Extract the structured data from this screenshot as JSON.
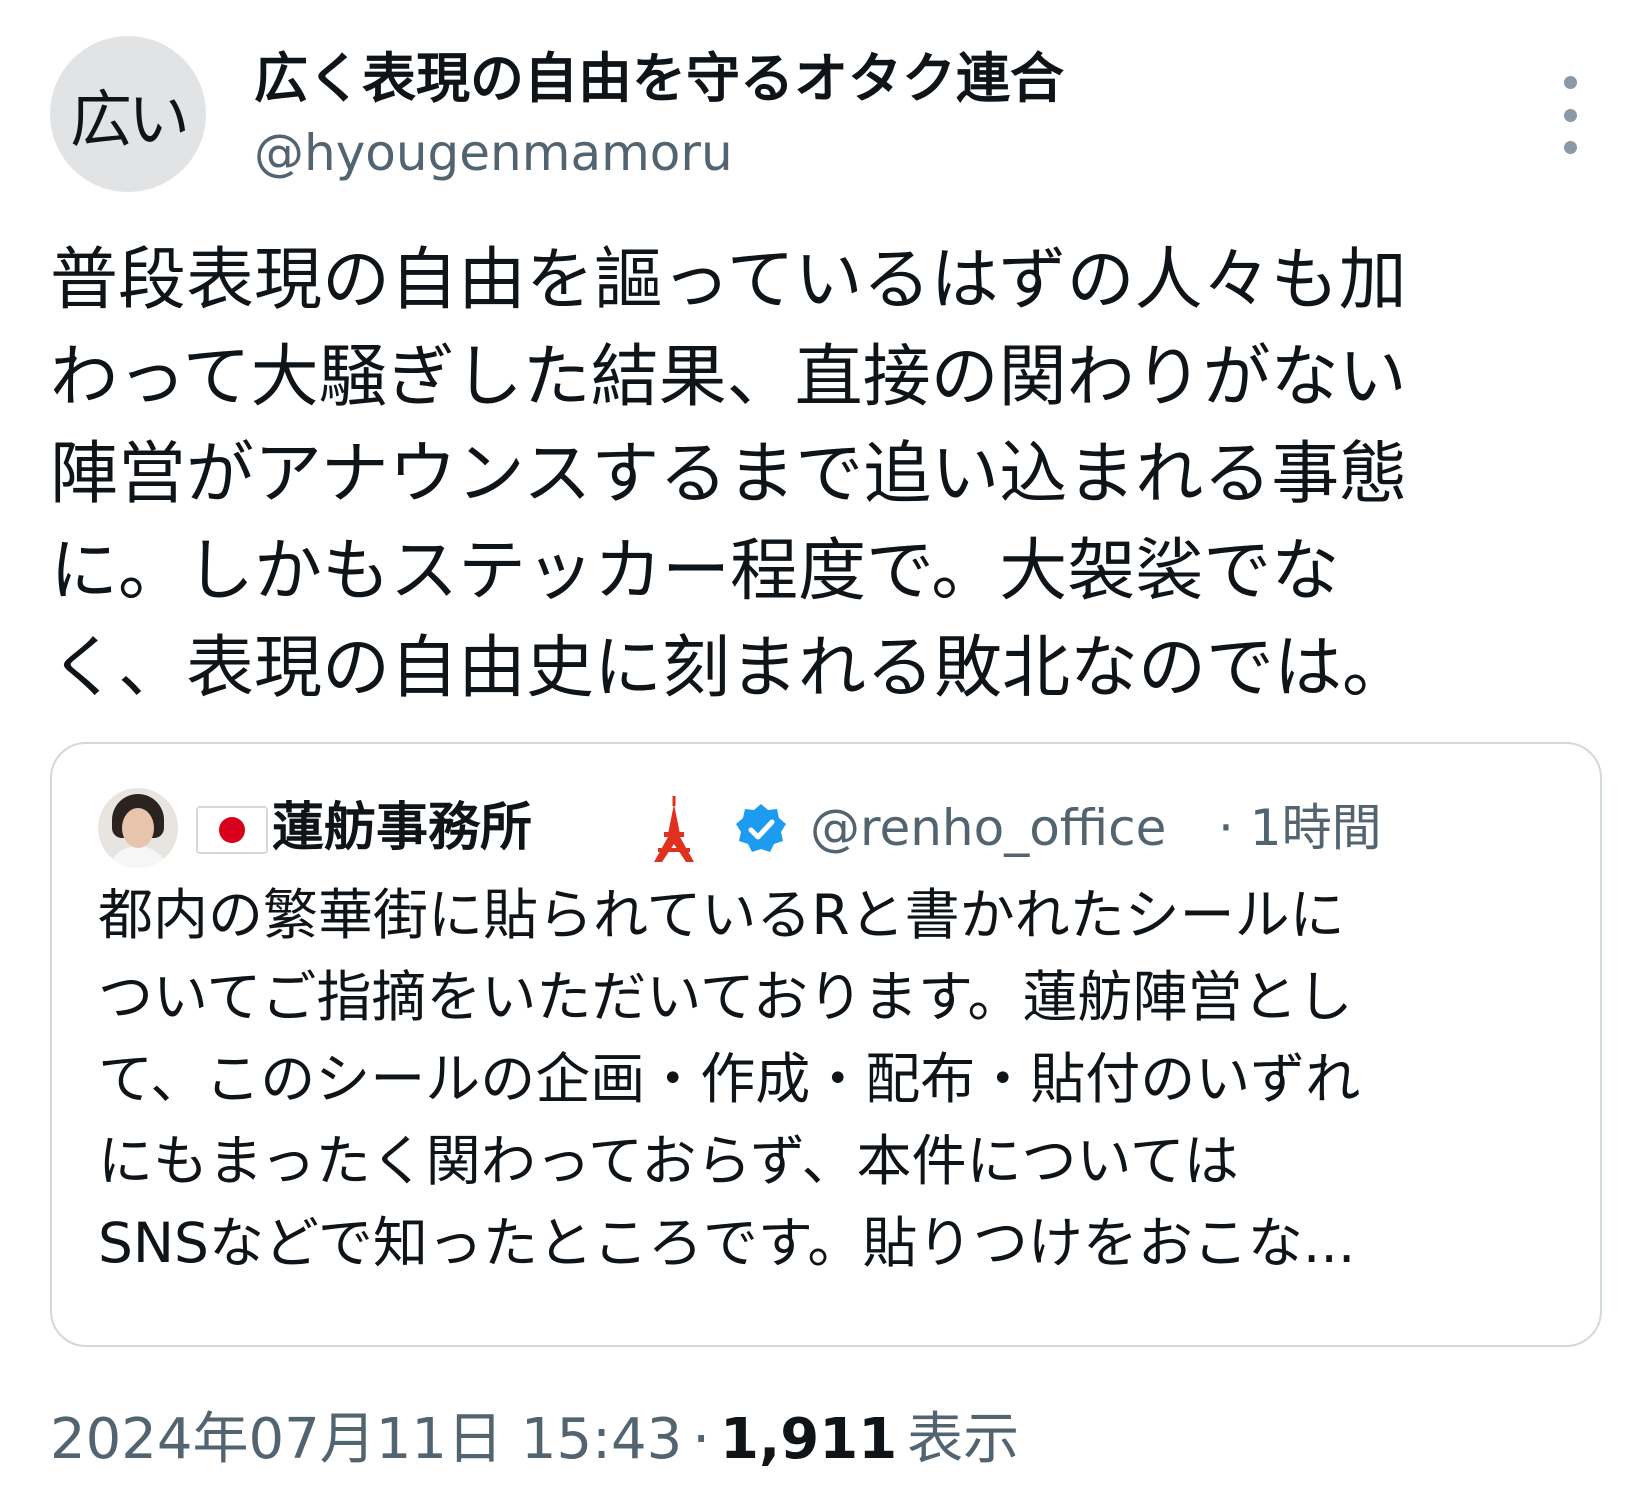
{
  "post": {
    "avatar_text": "広い",
    "author_name": "広く表現の自由を守るオタク連合",
    "author_handle": "@hyougenmamoru",
    "text": "普段表現の自由を謳っているはずの人々も加\nわって大騒ぎした結果、直接の関わりがない\n陣営がアナウンスするまで追い込まれる事態\nに。しかもステッカー程度で。大袈裟でな\nく、表現の自由史に刻まれる敗北なのでは。",
    "timestamp": "2024年07月11日 15:43",
    "separator": "·",
    "view_count": "1,911",
    "views_label": "表示"
  },
  "quote": {
    "author_name": "蓮舫事務所",
    "author_handle": "@renho_office",
    "time": "· 1時間",
    "text": "都内の繁華街に貼られているRと書かれたシールに\nついてご指摘をいただいております。蓮舫陣営とし\nて、このシールの企画・作成・配布・貼付のいずれ\nにもまったく関わっておらず、本件については\nSNSなどで知ったところです。貼りつけをおこな..."
  },
  "icons": {
    "more": "more-vertical-icon",
    "flag": "japan-flag-icon",
    "tower": "tokyo-tower-icon",
    "verified": "verified-badge-icon"
  },
  "colors": {
    "text_primary": "#0f1419",
    "text_secondary": "#536471",
    "border": "#cfd9de",
    "verified_blue": "#1d9bf0",
    "tower_red": "#e0301e",
    "flag_red": "#d9001b"
  }
}
